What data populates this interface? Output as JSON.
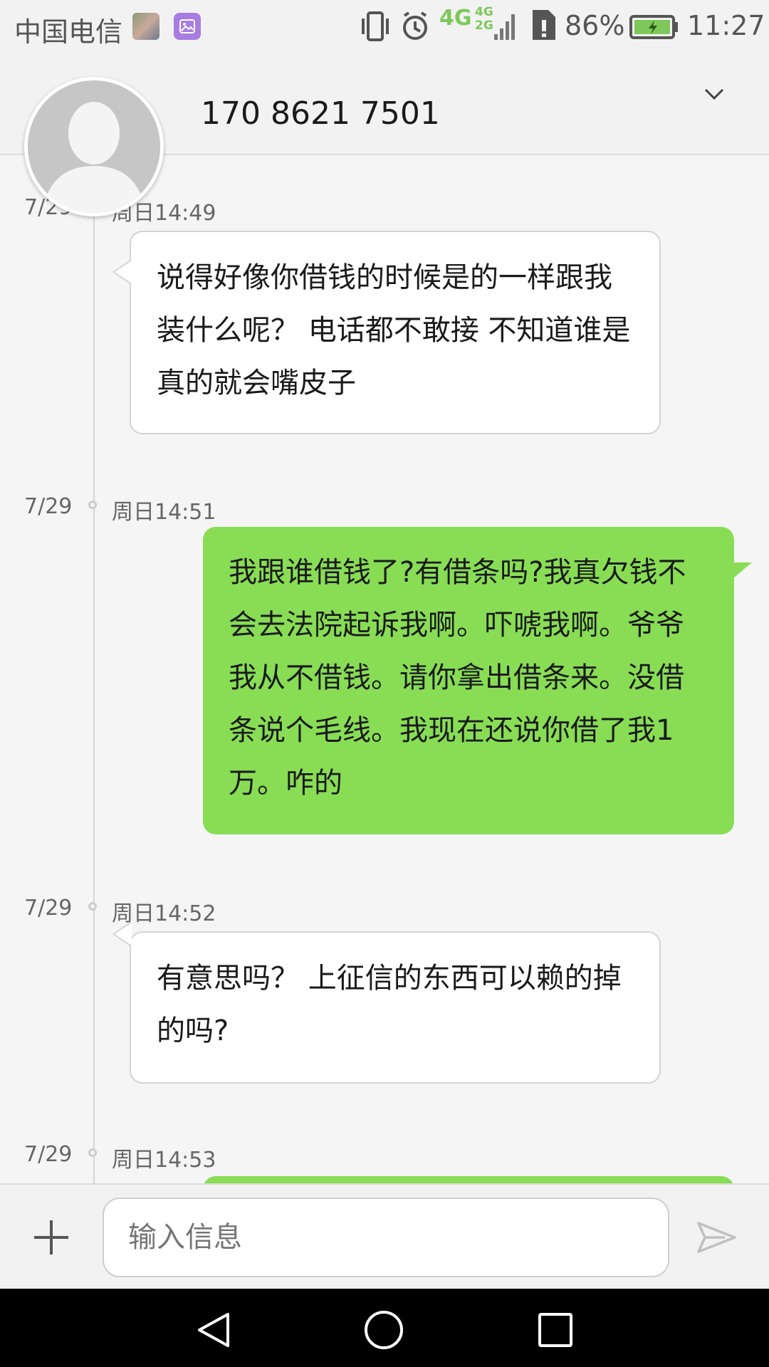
{
  "status_bar": {
    "carrier": "中国电信",
    "network": "4G",
    "network_small_top": "4G",
    "network_small_bottom": "2G",
    "battery_percent": "86%",
    "time": "11:27"
  },
  "header": {
    "contact": "170 8621 7501"
  },
  "messages": [
    {
      "date": "7/29",
      "time": "周日14:49",
      "direction": "incoming",
      "text": "说得好像你借钱的时候是的一样跟我装什么呢？ 电话都不敢接 不知道谁是真的就会嘴皮子"
    },
    {
      "date": "7/29",
      "time": "周日14:51",
      "direction": "outgoing",
      "text": "我跟谁借钱了?有借条吗?我真欠钱不会去法院起诉我啊。吓唬我啊。爷爷我从不借钱。请你拿出借条来。没借条说个毛线。我现在还说你借了我1万。咋的"
    },
    {
      "date": "7/29",
      "time": "周日14:52",
      "direction": "incoming",
      "text": "有意思吗？ 上征信的东西可以赖的掉的吗?"
    },
    {
      "date": "7/29",
      "time": "周日14:53",
      "direction": "outgoing",
      "text": ""
    }
  ],
  "composer": {
    "placeholder": "输入信息"
  },
  "colors": {
    "outgoing_bubble": "#88dd55",
    "incoming_bubble": "#ffffff",
    "network_accent": "#7dc85a",
    "gallery_badge": "#a77de0"
  },
  "icons": [
    "image-thumbnail-icon",
    "gallery-icon",
    "vibrate-icon",
    "alarm-icon",
    "signal-icon",
    "sim-icon",
    "battery-icon",
    "chevron-down-icon",
    "avatar-silhouette-icon",
    "add-icon",
    "send-icon",
    "back-icon",
    "home-icon",
    "recents-icon"
  ]
}
